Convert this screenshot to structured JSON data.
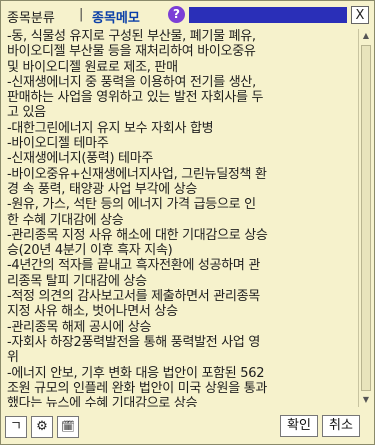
{
  "header": {
    "tab_category": "종목분류",
    "separator": "|",
    "tab_memo": "종목메모",
    "help_label": "?",
    "close_label": "X"
  },
  "memo_lines": [
    "-동, 식물성 유지로 구성된 부산물, 폐기물 폐유,",
    "바이오디젤 부산물 등을 재처리하여 바이오중유",
    "및 바이오디젤 원료로 제조, 판매",
    "-신재생에너지 중 풍력을 이용하여 전기를 생산,",
    "판매하는 사업을 영위하고 있는 발전 자회사를 두",
    "고 있음",
    "-대한그린에너지 유지 보수 자회사 합병",
    "-바이오디젤 테마주",
    "-신재생에너지(풍력) 테마주",
    "-바이오중유+신재생에너지사업, 그린뉴딜정책 환",
    "경 속 풍력, 태양광 사업 부각에 상승",
    "-원유, 가스, 석탄 등의 에너지 가격 급등으로 인",
    "한 수혜 기대감에 상승",
    "-관리종목 지정 사유 해소에 대한 기대감으로 상승",
    "승(20년 4분기 이후 흑자 지속)",
    "-4년간의 적자를 끝내고 흑자전환에 성공하며 관",
    "리종목 탈피 기대감에 상승",
    "-적정 의견의 감사보고서를 제출하면서 관리종목",
    "지정 사유 해소, 벗어나면서 상승",
    "-관리종목 해제 공시에 상승",
    "-자회사 하장2풍력발전을 통해 풍력발전 사업 영",
    "위",
    "-에너지 안보, 기후 변화 대응 법안이 포함된 562",
    "조원 규모의 인플레 완화 법안이 미국 상원을 통과",
    "했다는 뉴스에 수혜 기대감으로 상승"
  ],
  "scrollbar": {
    "up_icon": "triangle-up-icon",
    "down_icon": "triangle-down-icon"
  },
  "footer": {
    "btn1_icon": "corner-bracket-icon",
    "btn1_glyph": "ㄱ",
    "btn2_icon": "gear-icon",
    "btn2_glyph": "⚙",
    "btn3_icon": "calendar-clock-icon",
    "btn3_glyph": "🗓",
    "confirm_label": "확인",
    "cancel_label": "취소"
  },
  "colors": {
    "background": "#f6f2cc",
    "memo_tab": "#0a3fa8",
    "help_icon": "#7b3fd6",
    "title_bar_fill": "#2a2fb8"
  }
}
